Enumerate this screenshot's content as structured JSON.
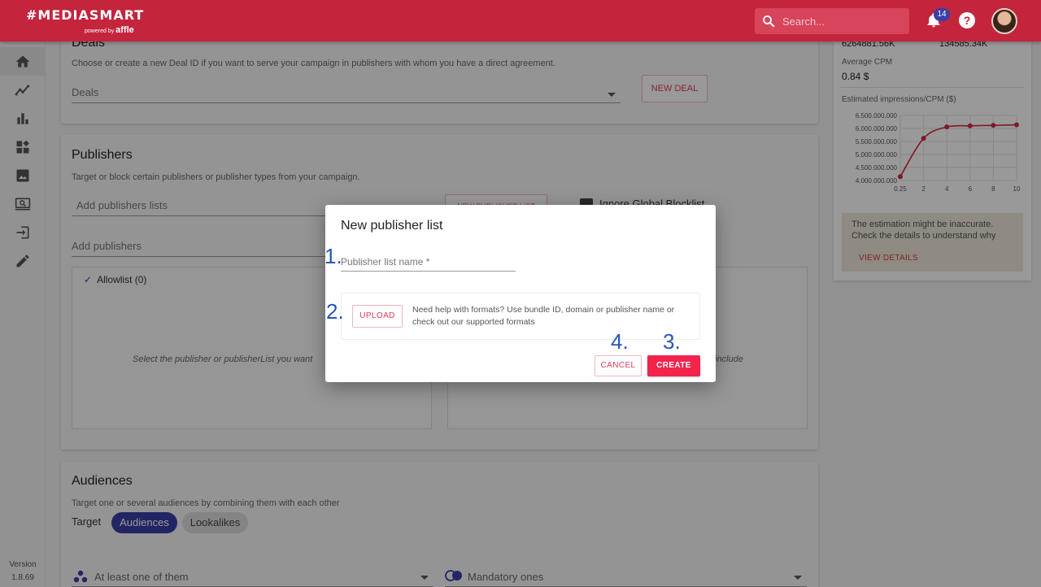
{
  "app": {
    "brand": "#MEDIASMART",
    "powered_by": "powered by",
    "powered_brand": "affle",
    "search_placeholder": "Search...",
    "notification_count": "14",
    "help_symbol": "?",
    "version_label": "Version",
    "version_number": "1.8.69"
  },
  "sidebar": {
    "items": [
      {
        "icon": "home-icon",
        "active": true
      },
      {
        "icon": "trending-icon"
      },
      {
        "icon": "bar-chart-icon"
      },
      {
        "icon": "widgets-icon"
      },
      {
        "icon": "image-icon"
      },
      {
        "icon": "monitor-search-icon"
      },
      {
        "icon": "login-icon"
      },
      {
        "icon": "edit-icon"
      }
    ]
  },
  "deals": {
    "title": "Deals",
    "description": "Choose or create a new Deal ID if you want to serve your campaign in publishers with whom you have a direct agreement.",
    "select_label": "Deals",
    "new_button": "NEW DEAL"
  },
  "publishers": {
    "title": "Publishers",
    "description": "Target or block certain publishers or publisher types from your campaign.",
    "lists_placeholder": "Add publishers lists",
    "new_list_button": "NEW PUBLISHER LIST",
    "ignore_blocklist": "Ignore Global Blocklist",
    "add_placeholder": "Add publishers",
    "allowlist_label": "Allowlist (0)",
    "empty_text_left": "Select the publisher or publisherList you want",
    "empty_text_right": "include"
  },
  "audiences": {
    "title": "Audiences",
    "description": "Target one or several audiences by combining them with each other",
    "target_label": "Target",
    "chips": [
      "Audiences",
      "Lookalikes"
    ],
    "select_left": "At least one of them",
    "select_right": "Mandatory ones"
  },
  "summary": {
    "value_left": "6264881.56K",
    "value_right": "134585.34K",
    "avg_cpm_label": "Average CPM",
    "avg_cpm_value": "0.84 $",
    "chart_title": "Estimated impressions/CPM ($)",
    "notice": "The estimation might be inaccurate. Check the details to understand why",
    "view_details": "VIEW DETAILS"
  },
  "chart_data": {
    "type": "line",
    "title": "Estimated impressions/CPM ($)",
    "x": [
      "0.25",
      "2",
      "4",
      "6",
      "8",
      "10"
    ],
    "values": [
      4150000000,
      5620000000,
      6060000000,
      6100000000,
      6120000000,
      6140000000
    ],
    "ylim": [
      4000000000,
      6500000000
    ],
    "ytick_labels": [
      "6.500.000.000",
      "6.000.000.000",
      "5.500.000.000",
      "5.000.000.000",
      "4.500.000.000",
      "4.000.000.000"
    ],
    "grid": true,
    "color": "#d6283f"
  },
  "dialog": {
    "title": "New publisher list",
    "name_placeholder": "Publisher list name *",
    "upload_button": "UPLOAD",
    "upload_help": "Need help with formats? Use bundle ID, domain or publisher name or check out our supported formats",
    "cancel_button": "CANCEL",
    "create_button": "CREATE"
  },
  "annotations": [
    "1.",
    "2.",
    "3.",
    "4."
  ],
  "colors": {
    "brand": "#c4243c",
    "accent": "#f2244d",
    "chip": "#3a3fa7",
    "annotation": "#2657b8"
  }
}
